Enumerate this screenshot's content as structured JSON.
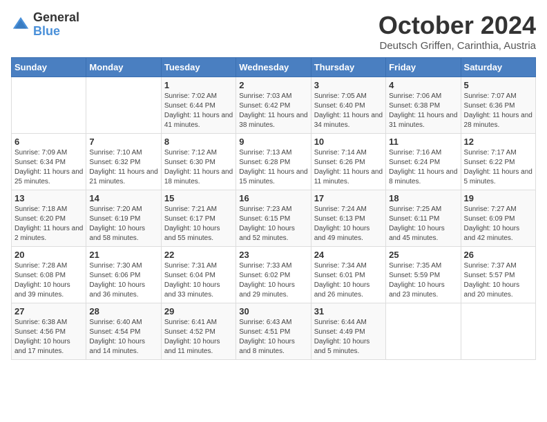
{
  "logo": {
    "general": "General",
    "blue": "Blue"
  },
  "header": {
    "month": "October 2024",
    "location": "Deutsch Griffen, Carinthia, Austria"
  },
  "days_of_week": [
    "Sunday",
    "Monday",
    "Tuesday",
    "Wednesday",
    "Thursday",
    "Friday",
    "Saturday"
  ],
  "weeks": [
    [
      {
        "day": "",
        "info": ""
      },
      {
        "day": "",
        "info": ""
      },
      {
        "day": "1",
        "info": "Sunrise: 7:02 AM\nSunset: 6:44 PM\nDaylight: 11 hours and 41 minutes."
      },
      {
        "day": "2",
        "info": "Sunrise: 7:03 AM\nSunset: 6:42 PM\nDaylight: 11 hours and 38 minutes."
      },
      {
        "day": "3",
        "info": "Sunrise: 7:05 AM\nSunset: 6:40 PM\nDaylight: 11 hours and 34 minutes."
      },
      {
        "day": "4",
        "info": "Sunrise: 7:06 AM\nSunset: 6:38 PM\nDaylight: 11 hours and 31 minutes."
      },
      {
        "day": "5",
        "info": "Sunrise: 7:07 AM\nSunset: 6:36 PM\nDaylight: 11 hours and 28 minutes."
      }
    ],
    [
      {
        "day": "6",
        "info": "Sunrise: 7:09 AM\nSunset: 6:34 PM\nDaylight: 11 hours and 25 minutes."
      },
      {
        "day": "7",
        "info": "Sunrise: 7:10 AM\nSunset: 6:32 PM\nDaylight: 11 hours and 21 minutes."
      },
      {
        "day": "8",
        "info": "Sunrise: 7:12 AM\nSunset: 6:30 PM\nDaylight: 11 hours and 18 minutes."
      },
      {
        "day": "9",
        "info": "Sunrise: 7:13 AM\nSunset: 6:28 PM\nDaylight: 11 hours and 15 minutes."
      },
      {
        "day": "10",
        "info": "Sunrise: 7:14 AM\nSunset: 6:26 PM\nDaylight: 11 hours and 11 minutes."
      },
      {
        "day": "11",
        "info": "Sunrise: 7:16 AM\nSunset: 6:24 PM\nDaylight: 11 hours and 8 minutes."
      },
      {
        "day": "12",
        "info": "Sunrise: 7:17 AM\nSunset: 6:22 PM\nDaylight: 11 hours and 5 minutes."
      }
    ],
    [
      {
        "day": "13",
        "info": "Sunrise: 7:18 AM\nSunset: 6:20 PM\nDaylight: 11 hours and 2 minutes."
      },
      {
        "day": "14",
        "info": "Sunrise: 7:20 AM\nSunset: 6:19 PM\nDaylight: 10 hours and 58 minutes."
      },
      {
        "day": "15",
        "info": "Sunrise: 7:21 AM\nSunset: 6:17 PM\nDaylight: 10 hours and 55 minutes."
      },
      {
        "day": "16",
        "info": "Sunrise: 7:23 AM\nSunset: 6:15 PM\nDaylight: 10 hours and 52 minutes."
      },
      {
        "day": "17",
        "info": "Sunrise: 7:24 AM\nSunset: 6:13 PM\nDaylight: 10 hours and 49 minutes."
      },
      {
        "day": "18",
        "info": "Sunrise: 7:25 AM\nSunset: 6:11 PM\nDaylight: 10 hours and 45 minutes."
      },
      {
        "day": "19",
        "info": "Sunrise: 7:27 AM\nSunset: 6:09 PM\nDaylight: 10 hours and 42 minutes."
      }
    ],
    [
      {
        "day": "20",
        "info": "Sunrise: 7:28 AM\nSunset: 6:08 PM\nDaylight: 10 hours and 39 minutes."
      },
      {
        "day": "21",
        "info": "Sunrise: 7:30 AM\nSunset: 6:06 PM\nDaylight: 10 hours and 36 minutes."
      },
      {
        "day": "22",
        "info": "Sunrise: 7:31 AM\nSunset: 6:04 PM\nDaylight: 10 hours and 33 minutes."
      },
      {
        "day": "23",
        "info": "Sunrise: 7:33 AM\nSunset: 6:02 PM\nDaylight: 10 hours and 29 minutes."
      },
      {
        "day": "24",
        "info": "Sunrise: 7:34 AM\nSunset: 6:01 PM\nDaylight: 10 hours and 26 minutes."
      },
      {
        "day": "25",
        "info": "Sunrise: 7:35 AM\nSunset: 5:59 PM\nDaylight: 10 hours and 23 minutes."
      },
      {
        "day": "26",
        "info": "Sunrise: 7:37 AM\nSunset: 5:57 PM\nDaylight: 10 hours and 20 minutes."
      }
    ],
    [
      {
        "day": "27",
        "info": "Sunrise: 6:38 AM\nSunset: 4:56 PM\nDaylight: 10 hours and 17 minutes."
      },
      {
        "day": "28",
        "info": "Sunrise: 6:40 AM\nSunset: 4:54 PM\nDaylight: 10 hours and 14 minutes."
      },
      {
        "day": "29",
        "info": "Sunrise: 6:41 AM\nSunset: 4:52 PM\nDaylight: 10 hours and 11 minutes."
      },
      {
        "day": "30",
        "info": "Sunrise: 6:43 AM\nSunset: 4:51 PM\nDaylight: 10 hours and 8 minutes."
      },
      {
        "day": "31",
        "info": "Sunrise: 6:44 AM\nSunset: 4:49 PM\nDaylight: 10 hours and 5 minutes."
      },
      {
        "day": "",
        "info": ""
      },
      {
        "day": "",
        "info": ""
      }
    ]
  ]
}
